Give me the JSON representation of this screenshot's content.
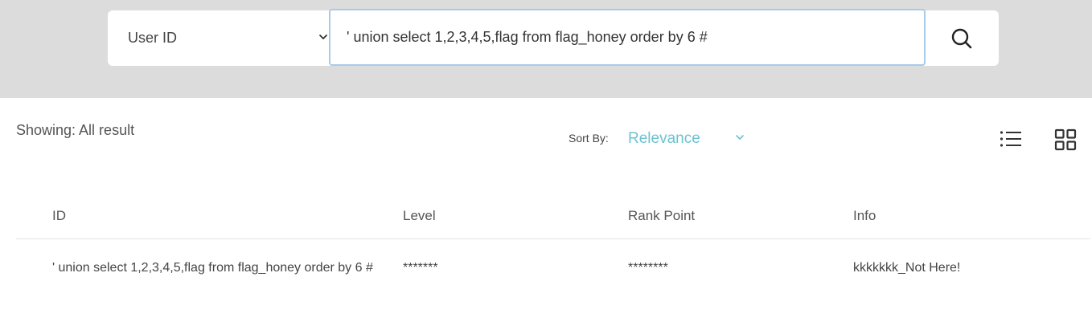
{
  "search": {
    "filter_selected": "User ID",
    "query_value": "' union select 1,2,3,4,5,flag from flag_honey order by 6 #"
  },
  "results": {
    "showing_text": "Showing: All result",
    "sort_label": "Sort By:",
    "sort_selected": "Relevance"
  },
  "table": {
    "headers": [
      "ID",
      "Level",
      "Rank Point",
      "Info"
    ],
    "rows": [
      {
        "id": "' union select 1,2,3,4,5,flag from flag_honey order by 6 #",
        "level": "*******",
        "rank_point": "********",
        "info": "kkkkkkk_Not Here!"
      }
    ]
  },
  "icons": {
    "filter_dropdown": "chevron-down-icon",
    "search": "search-icon",
    "sort_dropdown": "chevron-down-icon",
    "list_view": "list-view-icon",
    "grid_view": "grid-view-icon"
  },
  "colors": {
    "top_band": "#dcdcdc",
    "input_focus_border": "#a9cbea",
    "sort_accent": "#6cc3cf"
  }
}
